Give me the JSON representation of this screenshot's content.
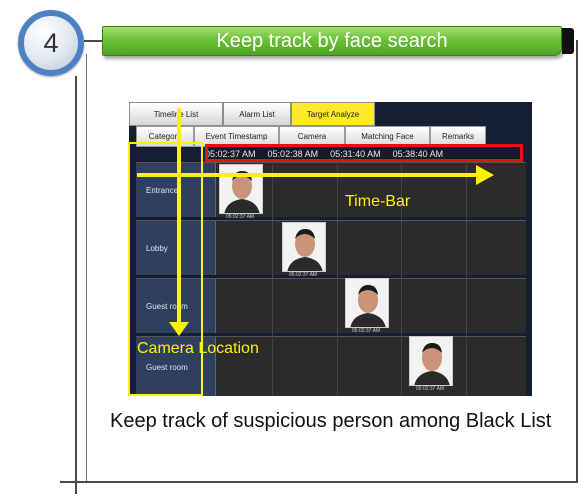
{
  "step_number": "4",
  "title": "Keep track by face search",
  "screenshot": {
    "tabs": [
      {
        "label": "Timeline List",
        "active": false
      },
      {
        "label": "Alarm List",
        "active": false
      },
      {
        "label": "Target Analyze",
        "active": true
      }
    ],
    "columns": [
      "Category",
      "Event Timestamp",
      "Camera",
      "Matching Face",
      "Remarks"
    ],
    "timestamps": [
      "05:02:37  AM",
      "05:02:38  AM",
      "05:31:40  AM",
      "05:38:40  AM"
    ],
    "rows": [
      {
        "camera": "Entrance",
        "face_time": "05:02:37 AM"
      },
      {
        "camera": "Lobby",
        "face_time": "05:02:37 AM"
      },
      {
        "camera": "Guest room",
        "face_time": "05:02:37 AM"
      },
      {
        "camera": "Guest room",
        "face_time": "05:02:37 AM"
      }
    ]
  },
  "annotations": {
    "time_bar": "Time-Bar",
    "camera_location": "Camera Location"
  },
  "caption": "Keep track of suspicious person among Black List",
  "colors": {
    "badge_ring": "#4c82c4",
    "title_green": "#6cc236",
    "highlight_red": "#e01418",
    "highlight_yellow": "#fff200",
    "active_tab": "#ffe82a"
  }
}
